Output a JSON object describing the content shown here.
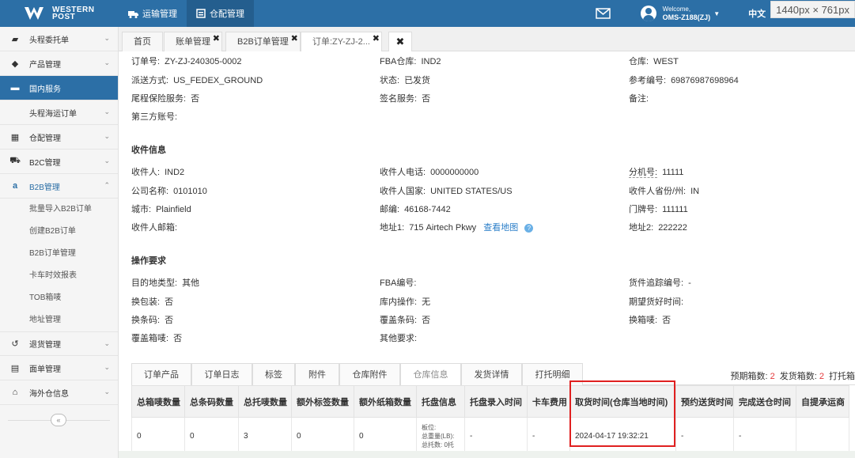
{
  "brand": {
    "line1": "WESTERN",
    "line2": "POST"
  },
  "topnav": [
    {
      "label": "运输管理",
      "active": false
    },
    {
      "label": "仓配管理",
      "active": true
    }
  ],
  "user": {
    "welcome": "Welcome,",
    "name": "OMS-Z188(ZJ)"
  },
  "lang": "中文",
  "dimension_badge": "1440px × 761px",
  "sidebar": {
    "items": [
      {
        "label": "头程委托单",
        "icon": "briefcase-icon"
      },
      {
        "label": "产品管理",
        "icon": "tag-icon"
      },
      {
        "label": "国内服务",
        "icon": "folder-icon"
      },
      {
        "label": "头程海运订单",
        "icon": ""
      },
      {
        "label": "仓配管理",
        "icon": "grid-icon"
      },
      {
        "label": "B2C管理",
        "icon": "cart-icon"
      },
      {
        "label": "B2B管理",
        "icon": "amazon-icon"
      }
    ],
    "b2b_sub": [
      "批量导入B2B订单",
      "创建B2B订单",
      "B2B订单管理",
      "卡车时效报表",
      "TOB箱唛",
      "地址管理"
    ],
    "bottom_items": [
      {
        "label": "退货管理",
        "icon": "return-icon"
      },
      {
        "label": "面单管理",
        "icon": "document-icon"
      },
      {
        "label": "海外仓信息",
        "icon": "home-icon"
      }
    ],
    "collapse": "«"
  },
  "tabs": [
    {
      "label": "首页"
    },
    {
      "label": "账单管理",
      "close": "✖"
    },
    {
      "label": "B2B订单管理",
      "close": "✖"
    },
    {
      "label": "订单:ZY-ZJ-2...",
      "close": "✖"
    }
  ],
  "tabs_close_all": "✖",
  "order": {
    "order_no_label": "订单号:",
    "order_no": "ZY-ZJ-240305-0002",
    "fba_warehouse_label": "FBA仓库:",
    "fba_warehouse": "IND2",
    "warehouse_label": "仓库:",
    "warehouse": "WEST",
    "delivery_label": "派送方式:",
    "delivery": "US_FEDEX_GROUND",
    "status_label": "状态:",
    "status": "已发货",
    "ref_label": "参考编号:",
    "ref": "69876987698964",
    "insurance_label": "尾程保险服务:",
    "insurance": "否",
    "signature_label": "签名服务:",
    "signature": "否",
    "remark_label": "备注:",
    "third_party_label": "第三方账号:"
  },
  "receiver": {
    "title": "收件信息",
    "name_label": "收件人:",
    "name": "IND2",
    "phone_label": "收件人电话:",
    "phone": "0000000000",
    "ext_label": "分机号:",
    "ext": "11111",
    "company_label": "公司名称:",
    "company": "0101010",
    "country_label": "收件人国家:",
    "country": "UNITED STATES/US",
    "state_label": "收件人省份/州:",
    "state": "IN",
    "city_label": "城市:",
    "city": "Plainfield",
    "zip_label": "邮编:",
    "zip": "46168-7442",
    "door_label": "门牌号:",
    "door": "111111",
    "email_label": "收件人邮箱:",
    "address1_label": "地址1:",
    "address1": "715 Airtech Pkwy",
    "map_link": "查看地图",
    "address2_label": "地址2:",
    "address2": "222222"
  },
  "operation": {
    "title": "操作要求",
    "dest_type_label": "目的地类型:",
    "dest_type": "其他",
    "fba_no_label": "FBA编号:",
    "tracking_label": "货件追踪编号:",
    "tracking": "-",
    "repack_label": "换包装:",
    "repack": "否",
    "inbound_op_label": "库内操作:",
    "inbound_op": "无",
    "expected_time_label": "期望货好时间:",
    "rebarcode_label": "换条码:",
    "rebarcode": "否",
    "cover_barcode_label": "覆盖条码:",
    "cover_barcode": "否",
    "change_mark_label": "换箱唛:",
    "change_mark": "否",
    "cover_mark_label": "覆盖箱唛:",
    "cover_mark": "否",
    "other_label": "其他要求:"
  },
  "inner_tabs": [
    "订单产品",
    "订单日志",
    "标签",
    "附件",
    "仓库附件",
    "仓库信息",
    "发货详情",
    "打托明细"
  ],
  "counts": {
    "expected_label": "预期箱数:",
    "expected": "2",
    "shipped_label": "发货箱数:",
    "shipped": "2",
    "pallet_label": "打托箱"
  },
  "table": {
    "headers": [
      "总箱唛数量",
      "总条码数量",
      "总托唛数量",
      "额外标签数量",
      "额外纸箱数量",
      "托盘信息",
      "托盘录入时间",
      "卡车费用",
      "取货时间(仓库当地时间)",
      "预约送货时间",
      "完成送仓时间",
      "自提承运商"
    ],
    "row": [
      "0",
      "0",
      "3",
      "0",
      "0",
      "",
      "-",
      "-",
      "2024-04-17 19:32:21",
      "-",
      "-",
      ""
    ],
    "pallet_lines": [
      "板位:",
      "总重量(LB):",
      "总托数: 0托"
    ]
  }
}
